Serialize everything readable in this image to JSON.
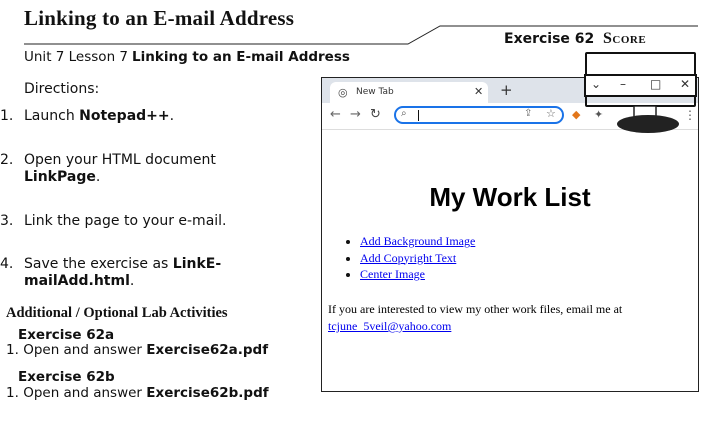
{
  "header": {
    "title": "Linking to an E-mail Address",
    "exercise": "Exercise 62",
    "score": "Score",
    "unit_lesson": "Unit 7 Lesson 7",
    "lesson_title": "Linking to an E-mail Address"
  },
  "directions": {
    "label": "Directions:",
    "steps": [
      {
        "num": "1.",
        "pre": "Launch ",
        "bold": "Notepad++",
        "post": "."
      },
      {
        "num": "2.",
        "pre": "Open your HTML document ",
        "bold": "LinkPage",
        "post": "."
      },
      {
        "num": "3.",
        "pre": "Link the page to your e-mail.",
        "bold": "",
        "post": ""
      },
      {
        "num": "4.",
        "pre": "Save the exercise as ",
        "bold": "LinkE-mailAdd.html",
        "post": "."
      }
    ]
  },
  "additional": {
    "heading": "Additional / Optional Lab Activities",
    "exercises": [
      {
        "title": "Exercise 62a",
        "num": "1.",
        "pre": "Open and answer ",
        "bold": "Exercise62a.pdf"
      },
      {
        "title": "Exercise 62b",
        "num": "1.",
        "pre": "Open and answer ",
        "bold": "Exercise62b.pdf"
      }
    ]
  },
  "browser": {
    "tab_title": "New Tab",
    "icons": {
      "favicon": "chrome-icon",
      "close": "close-icon",
      "new_tab": "plus-icon",
      "back": "back-arrow-icon",
      "forward": "forward-arrow-icon",
      "reload": "reload-icon",
      "search": "search-icon",
      "share": "share-icon",
      "bookmark": "star-icon",
      "extension_fox": "metamask-icon",
      "extensions": "puzzle-icon",
      "menu": "kebab-menu-icon",
      "minimize": "minimize-icon",
      "maximize": "maximize-icon",
      "window_close": "close-icon"
    },
    "accent_color": "#1a73e8",
    "link_color": "#0000ee"
  },
  "page": {
    "heading": "My Work List",
    "links": [
      "Add Background Image",
      "Add Copyright Text",
      "Center Image"
    ],
    "paragraph": "If you are interested to view my other work files, email me at",
    "email": "tcjune_5veil@yahoo.com"
  }
}
